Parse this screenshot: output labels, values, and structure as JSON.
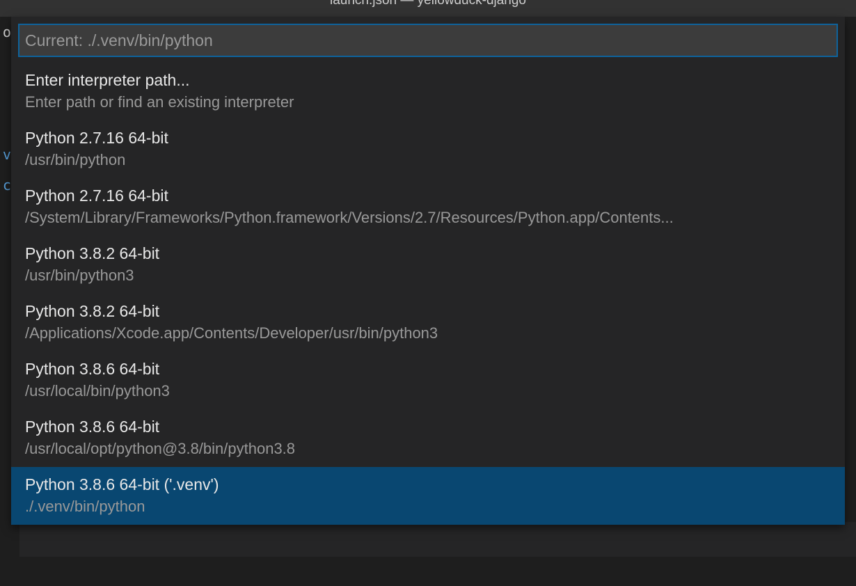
{
  "titleBar": {
    "text": "launch.json — yellowduck-django"
  },
  "sideFragments": [
    {
      "text": "or",
      "cls": "side-or"
    },
    {
      "text": "}",
      "cls": "side-brace"
    },
    {
      "text": "",
      "cls": ""
    },
    {
      "text": "/",
      "cls": "side-slash"
    },
    {
      "text": "/",
      "cls": "side-slash"
    },
    {
      "text": "",
      "cls": ""
    },
    {
      "text": "ve",
      "cls": "side-ve"
    },
    {
      "text": "co",
      "cls": "side-co"
    }
  ],
  "picker": {
    "placeholder": "Current: ./.venv/bin/python",
    "items": [
      {
        "label": "Enter interpreter path...",
        "description": "Enter path or find an existing interpreter",
        "selected": false
      },
      {
        "label": "Python 2.7.16 64-bit",
        "description": "/usr/bin/python",
        "selected": false
      },
      {
        "label": "Python 2.7.16 64-bit",
        "description": "/System/Library/Frameworks/Python.framework/Versions/2.7/Resources/Python.app/Contents...",
        "selected": false
      },
      {
        "label": "Python 3.8.2 64-bit",
        "description": "/usr/bin/python3",
        "selected": false
      },
      {
        "label": "Python 3.8.2 64-bit",
        "description": "/Applications/Xcode.app/Contents/Developer/usr/bin/python3",
        "selected": false
      },
      {
        "label": "Python 3.8.6 64-bit",
        "description": "/usr/local/bin/python3",
        "selected": false
      },
      {
        "label": "Python 3.8.6 64-bit",
        "description": "/usr/local/opt/python@3.8/bin/python3.8",
        "selected": false
      },
      {
        "label": "Python 3.8.6 64-bit ('.venv')",
        "description": "./.venv/bin/python",
        "selected": true
      }
    ]
  }
}
